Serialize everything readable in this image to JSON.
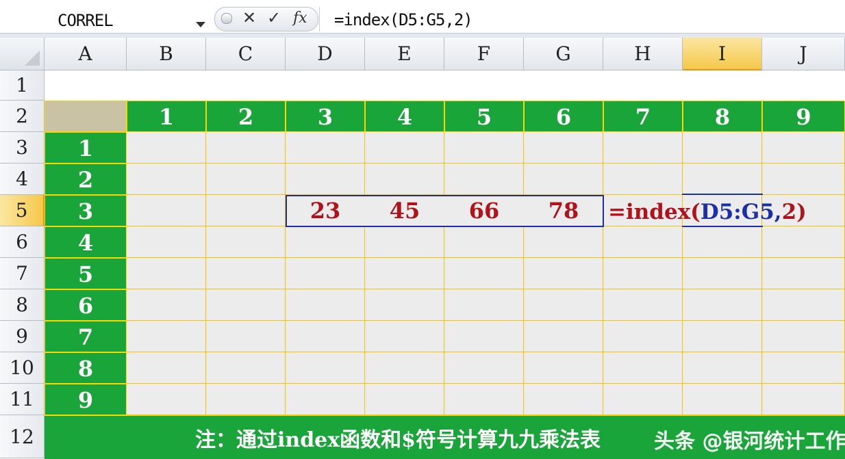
{
  "formula_bar": {
    "name_box": "CORREL",
    "cancel_symbol": "✕",
    "enter_symbol": "✓",
    "fx_symbol": "fx",
    "formula": "=index(D5:G5,2)"
  },
  "columns": [
    "A",
    "B",
    "C",
    "D",
    "E",
    "F",
    "G",
    "H",
    "I",
    "J"
  ],
  "selected_column": "I",
  "rows": [
    "1",
    "2",
    "3",
    "4",
    "5",
    "6",
    "7",
    "8",
    "9",
    "10",
    "11",
    "12"
  ],
  "selected_row": "5",
  "header_numbers": [
    "1",
    "2",
    "3",
    "4",
    "5",
    "6",
    "7",
    "8",
    "9"
  ],
  "row_numbers": [
    "1",
    "2",
    "3",
    "4",
    "5",
    "6",
    "7",
    "8",
    "9"
  ],
  "row5_values": [
    "23",
    "45",
    "66",
    "78"
  ],
  "annotation": {
    "prefix": "=index(",
    "range": "D5:G5,",
    "suffix": "2)"
  },
  "note": "注：通过index函数和$符号计算九九乘法表",
  "watermark": "头条 @银河统计工作室",
  "colors": {
    "green": "#1aa53a",
    "gold": "#ffd700",
    "red_text": "#b0131c",
    "blue_text": "#1c2fa8",
    "selected_header": "#f5c84a"
  }
}
